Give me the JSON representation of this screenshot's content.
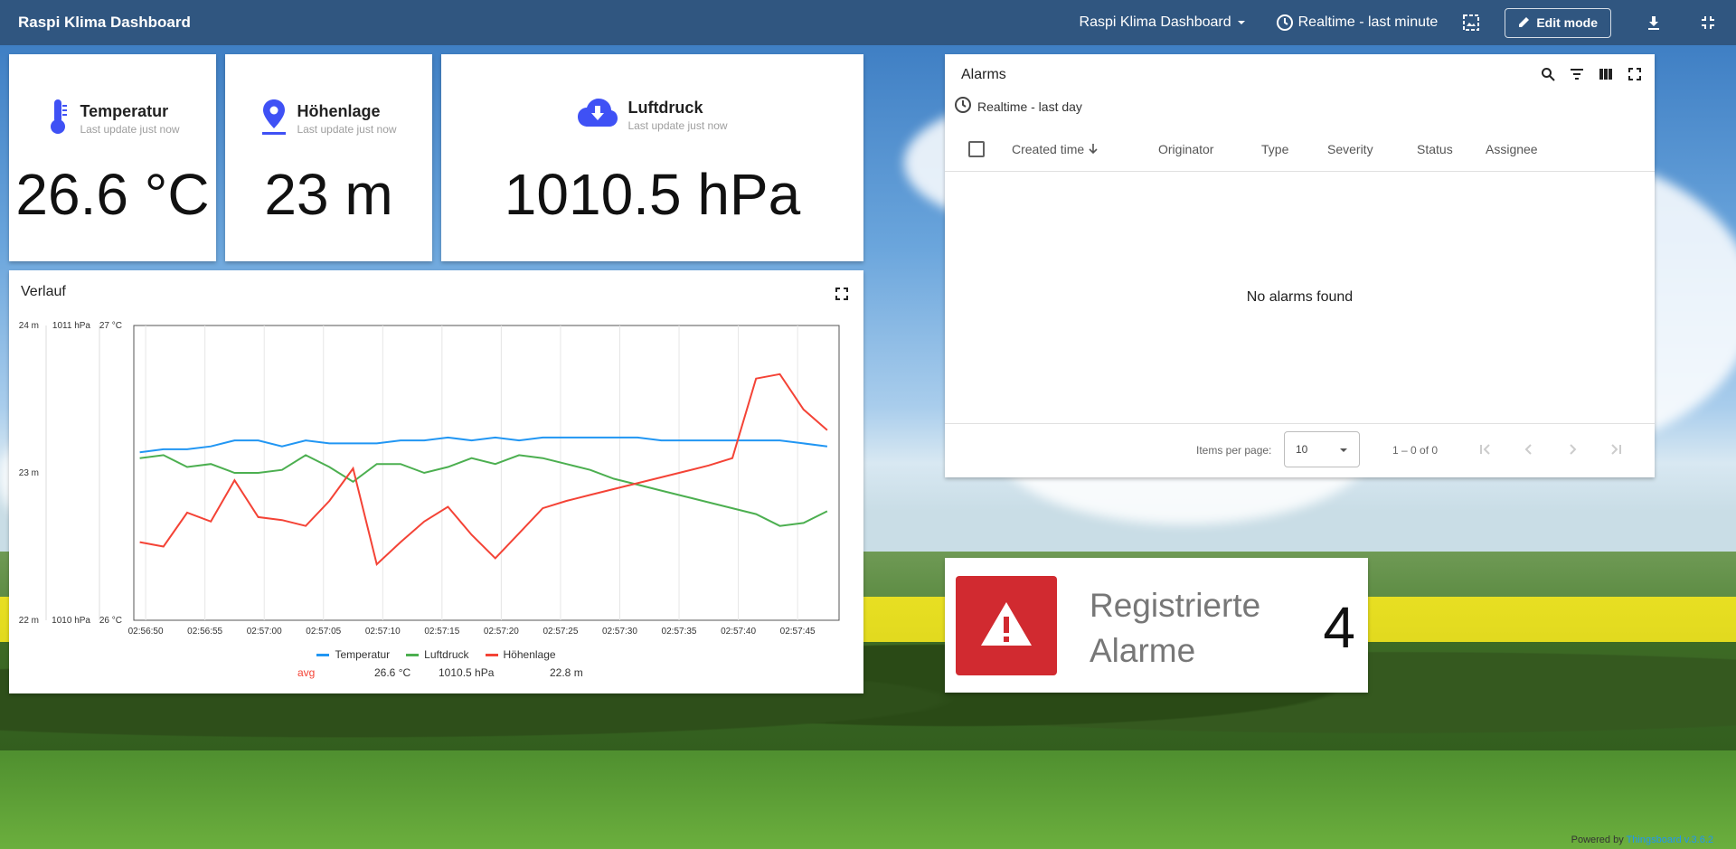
{
  "toolbar": {
    "title": "Raspi Klima Dashboard",
    "dashboard_select": "Raspi Klima Dashboard",
    "timewindow": "Realtime - last minute",
    "edit_mode": "Edit mode"
  },
  "cards": [
    {
      "title": "Temperatur",
      "subtitle": "Last update just now",
      "value": "26.6 °C",
      "icon": "thermometer-icon"
    },
    {
      "title": "Höhenlage",
      "subtitle": "Last update just now",
      "value": "23 m",
      "icon": "map-pin-icon"
    },
    {
      "title": "Luftdruck",
      "subtitle": "Last update just now",
      "value": "1010.5 hPa",
      "icon": "cloud-download-icon"
    }
  ],
  "verlauf": {
    "title": "Verlauf",
    "avg_label": "avg",
    "avgs": [
      "26.6 °C",
      "1010.5 hPa",
      "22.8 m"
    ]
  },
  "chart_data": {
    "type": "line",
    "x": [
      "02:56:50",
      "02:56:55",
      "02:57:00",
      "02:57:05",
      "02:57:10",
      "02:57:15",
      "02:57:20",
      "02:57:25",
      "02:57:30",
      "02:57:35",
      "02:57:40",
      "02:57:45"
    ],
    "y_axes": [
      {
        "ticks": [
          "24 m",
          "23 m",
          "22 m"
        ],
        "range": [
          22,
          24
        ],
        "unit": "m"
      },
      {
        "ticks": [
          "1011 hPa",
          "1010 hPa"
        ],
        "range": [
          1010,
          1011
        ],
        "unit": "hPa"
      },
      {
        "ticks": [
          "27 °C",
          "26 °C"
        ],
        "range": [
          26,
          27
        ],
        "unit": "°C"
      }
    ],
    "series": [
      {
        "name": "Temperatur",
        "color": "#2196f3",
        "axis": 2,
        "t": [
          -0.5,
          1.5,
          3.5,
          5.5,
          7.5,
          9.5,
          11.5,
          13.5,
          15.5,
          17.5,
          19.5,
          21.5,
          23.5,
          25.5,
          27.5,
          29.5,
          31.5,
          33.5,
          35.5,
          37.5,
          39.5,
          41.5,
          43.5,
          45.5,
          47.5,
          49.5,
          51.5,
          53.5,
          55.5,
          57.5
        ],
        "values": [
          26.57,
          26.58,
          26.58,
          26.59,
          26.61,
          26.61,
          26.59,
          26.61,
          26.6,
          26.6,
          26.6,
          26.61,
          26.61,
          26.62,
          26.61,
          26.62,
          26.61,
          26.62,
          26.62,
          26.62,
          26.62,
          26.62,
          26.61,
          26.61,
          26.61,
          26.61,
          26.61,
          26.61,
          26.6,
          26.59
        ]
      },
      {
        "name": "Luftdruck",
        "color": "#4caf50",
        "axis": 1,
        "t": [
          -0.5,
          1.5,
          3.5,
          5.5,
          7.5,
          9.5,
          11.5,
          13.5,
          15.5,
          17.5,
          19.5,
          21.5,
          23.5,
          25.5,
          27.5,
          29.5,
          31.5,
          33.5,
          35.5,
          37.5,
          39.5,
          41.5,
          43.5,
          45.5,
          47.5,
          49.5,
          51.5,
          53.5,
          55.5,
          57.5
        ],
        "values": [
          1010.55,
          1010.56,
          1010.52,
          1010.53,
          1010.5,
          1010.5,
          1010.51,
          1010.56,
          1010.52,
          1010.47,
          1010.53,
          1010.53,
          1010.5,
          1010.52,
          1010.55,
          1010.53,
          1010.56,
          1010.55,
          1010.53,
          1010.51,
          1010.48,
          1010.46,
          1010.44,
          1010.42,
          1010.4,
          1010.38,
          1010.36,
          1010.32,
          1010.33,
          1010.37
        ]
      },
      {
        "name": "Höhenlage",
        "color": "#f44336",
        "axis": 0,
        "t": [
          -0.5,
          1.5,
          3.5,
          5.5,
          7.5,
          9.5,
          11.5,
          13.5,
          15.5,
          17.5,
          19.5,
          21.5,
          23.5,
          25.5,
          27.5,
          29.5,
          31.5,
          33.5,
          35.5,
          37.5,
          39.5,
          41.5,
          43.5,
          45.5,
          47.5,
          49.5,
          51.5,
          53.5,
          55.5,
          57.5
        ],
        "values": [
          22.53,
          22.5,
          22.73,
          22.67,
          22.95,
          22.7,
          22.68,
          22.64,
          22.81,
          23.03,
          22.38,
          22.53,
          22.67,
          22.77,
          22.58,
          22.42,
          22.59,
          22.76,
          22.81,
          22.85,
          22.89,
          22.93,
          22.97,
          23.01,
          23.05,
          23.1,
          23.64,
          23.67,
          23.43,
          23.29
        ]
      }
    ]
  },
  "alarms": {
    "title": "Alarms",
    "timewindow": "Realtime - last day",
    "columns": [
      "Created time",
      "Originator",
      "Type",
      "Severity",
      "Status",
      "Assignee"
    ],
    "empty_text": "No alarms found",
    "items_per_page_label": "Items per page:",
    "items_per_page": "10",
    "range_label": "1 – 0 of 0"
  },
  "registered": {
    "label_line1": "Registrierte",
    "label_line2": "Alarme",
    "count": "4"
  },
  "footer": {
    "prefix": "Powered by",
    "brand": "Thingsboard v.3.6.2"
  }
}
